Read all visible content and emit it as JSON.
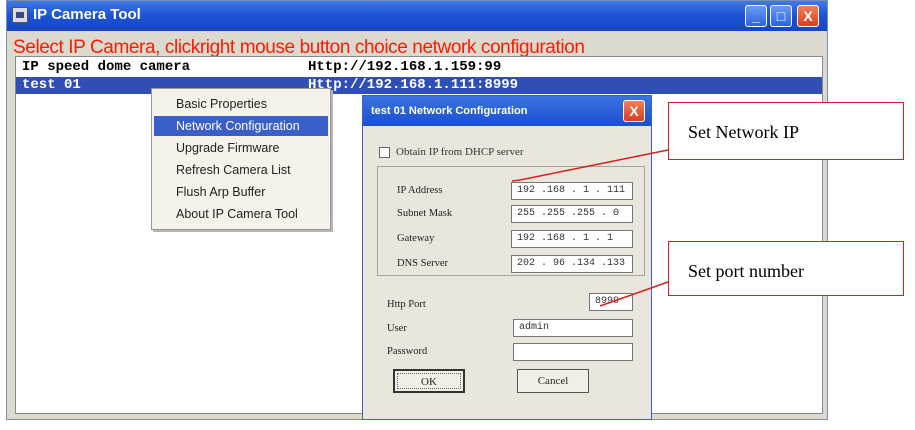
{
  "window": {
    "title": "IP Camera Tool",
    "buttons": {
      "minimize": "_",
      "maximize": "□",
      "close": "X"
    }
  },
  "banner": "Select IP Camera, clickright mouse button choice network configuration",
  "camera_list": [
    {
      "name": "IP speed dome camera",
      "url": "Http://192.168.1.159:99",
      "selected": false
    },
    {
      "name": "test 01",
      "url": "Http://192.168.1.111:8999",
      "selected": true
    }
  ],
  "context_menu": {
    "items": [
      {
        "label": "Basic Properties"
      },
      {
        "label": "Network Configuration"
      },
      {
        "label": "Upgrade Firmware"
      },
      {
        "label": "Refresh Camera List"
      },
      {
        "label": "Flush Arp Buffer"
      },
      {
        "label": "About IP Camera Tool"
      }
    ],
    "active_index": 1
  },
  "dialog": {
    "title": "test 01 Network Configuration",
    "close": "X",
    "dhcp_label": "Obtain IP from DHCP server",
    "ip_label": "IP Address",
    "ip_value": "192 .168 . 1 . 111",
    "mask_label": "Subnet Mask",
    "mask_value": "255 .255 .255 . 0",
    "gateway_label": "Gateway",
    "gateway_value": "192 .168 . 1 . 1",
    "dns_label": "DNS Server",
    "dns_value": "202 . 96 .134 .133",
    "http_port_label": "Http Port",
    "http_port_value": "8999",
    "user_label": "User",
    "user_value": "admin",
    "password_label": "Password",
    "password_value": "",
    "ok_label": "OK",
    "cancel_label": "Cancel"
  },
  "callouts": {
    "network_ip": "Set Network IP",
    "port_number": "Set port number"
  },
  "colors": {
    "banner": "#ff1a00",
    "selection": "#2f4fb5",
    "titlebar": "#1d55d6",
    "callout_border": "#d82020"
  }
}
